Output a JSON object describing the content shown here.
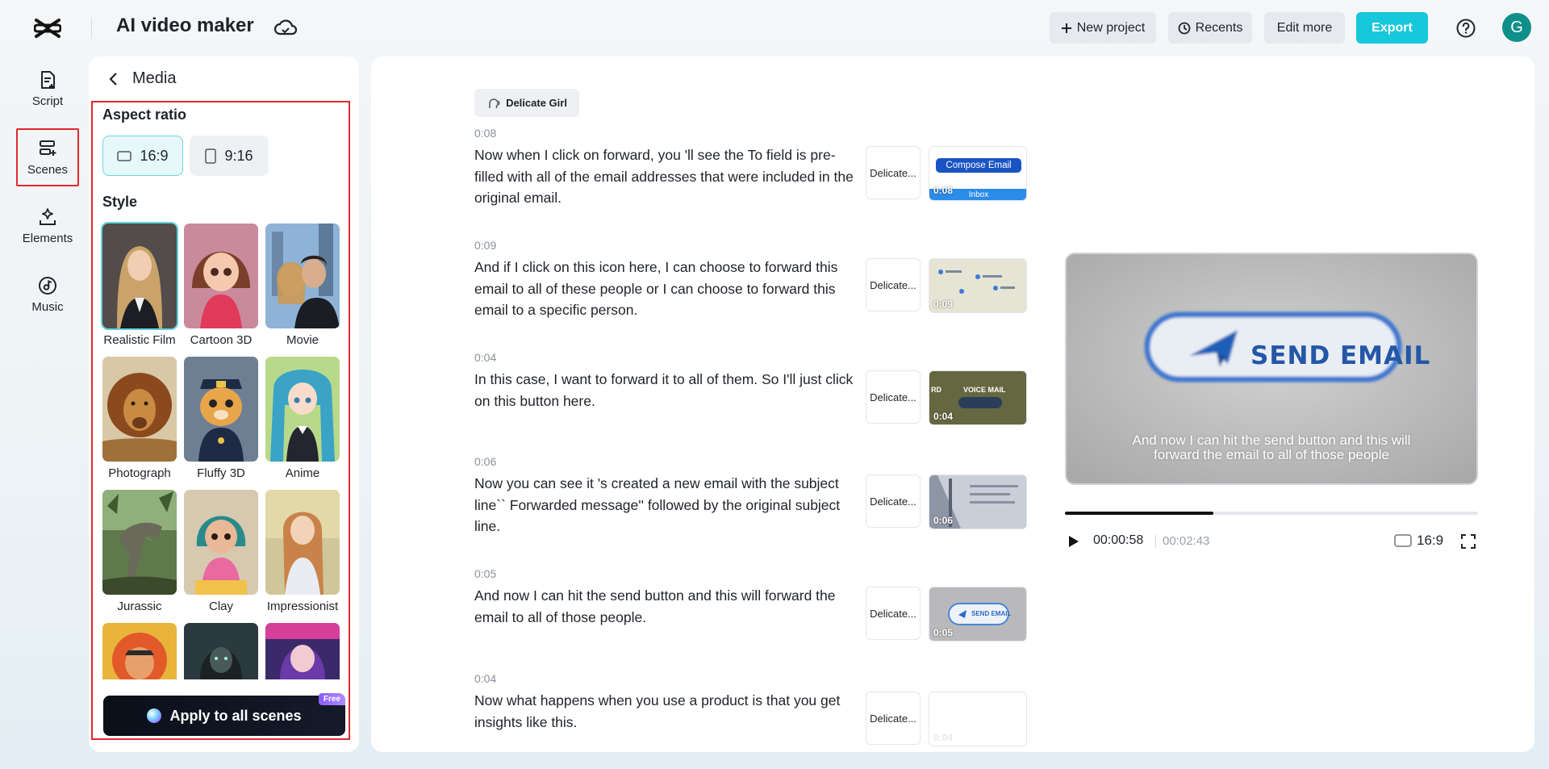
{
  "header": {
    "title": "AI video maker",
    "new_project": "New project",
    "recents": "Recents",
    "edit_more": "Edit more",
    "export": "Export",
    "avatar_letter": "G"
  },
  "rail": {
    "items": [
      {
        "label": "Script",
        "icon": "script-icon"
      },
      {
        "label": "Scenes",
        "icon": "scenes-icon"
      },
      {
        "label": "Elements",
        "icon": "elements-icon"
      },
      {
        "label": "Music",
        "icon": "music-icon"
      }
    ],
    "active": "Scenes"
  },
  "media_panel": {
    "title": "Media",
    "aspect_ratio_title": "Aspect ratio",
    "ratios": [
      "16:9",
      "9:16"
    ],
    "selected_ratio": "16:9",
    "style_title": "Style",
    "styles": [
      "Realistic Film",
      "Cartoon 3D",
      "Movie",
      "Photograph",
      "Fluffy 3D",
      "Anime",
      "Jurassic",
      "Clay",
      "Impressionist"
    ],
    "selected_style": "Realistic Film",
    "apply_button": "Apply to all scenes",
    "apply_badge": "Free"
  },
  "script": {
    "voice": "Delicate Girl",
    "scenes": [
      {
        "time": "0:08",
        "text": "Now when I click on forward, you 'll see the To field is pre-filled with all of the email addresses that were included in the original email.",
        "voice": "Delicate...",
        "thumb_time": "0:08",
        "thumb_text": [
          "Compose Email",
          "Inbox"
        ]
      },
      {
        "time": "0:09",
        "text": "And if I click on this icon here, I can choose to forward this email to all of these people or I can choose to forward this email to a specific person.",
        "voice": "Delicate...",
        "thumb_time": "0:09"
      },
      {
        "time": "0:04",
        "text": "In this case, I want to forward it to all of them. So I'll just click on this button here.",
        "voice": "Delicate...",
        "thumb_time": "0:04",
        "thumb_text": [
          "VOICE MAIL",
          "RD"
        ]
      },
      {
        "time": "0:06",
        "text": "Now you can see it 's created a new email with the subject line`` Forwarded message'' followed by the original subject line.",
        "voice": "Delicate...",
        "thumb_time": "0:06"
      },
      {
        "time": "0:05",
        "text": "And now I can hit the send button and this will forward the email to all of those people.",
        "voice": "Delicate...",
        "thumb_time": "0:05",
        "thumb_text": [
          "SEND EMAIL"
        ]
      },
      {
        "time": "0:04",
        "text": "Now what happens when you use a product is that you get insights like this.",
        "voice": "Delicate...",
        "thumb_time": "0:04"
      }
    ]
  },
  "preview": {
    "button_text": "SEND EMAIL",
    "caption_line1": "And now I can hit the send button and this will",
    "caption_line2": "forward the email to all of those people",
    "current_time": "00:00:58",
    "total_time": "00:02:43",
    "progress": 0.36,
    "ratio": "16:9"
  },
  "colors": {
    "accent": "#17c7dc",
    "highlight_box": "#e0282e"
  }
}
